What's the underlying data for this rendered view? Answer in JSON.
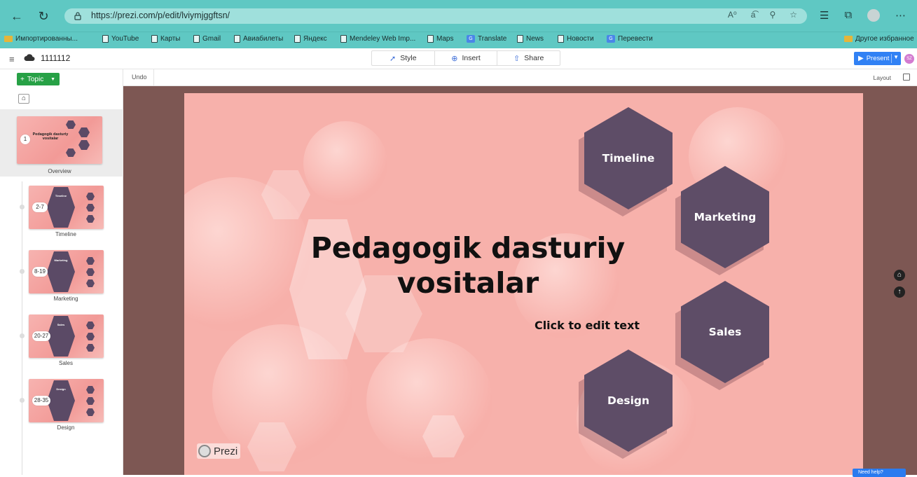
{
  "browser": {
    "url": "https://prezi.com/p/edit/lviymjggftsn/",
    "bookmarks": [
      {
        "label": "Импортированны...",
        "type": "folder"
      },
      {
        "label": "YouTube",
        "type": "page"
      },
      {
        "label": "Карты",
        "type": "page"
      },
      {
        "label": "Gmail",
        "type": "page"
      },
      {
        "label": "Авиабилеты",
        "type": "page"
      },
      {
        "label": "Яндекс",
        "type": "page"
      },
      {
        "label": "Mendeley Web Imp...",
        "type": "page"
      },
      {
        "label": "Maps",
        "type": "page"
      },
      {
        "label": "Translate",
        "type": "translate"
      },
      {
        "label": "News",
        "type": "page"
      },
      {
        "label": "Новости",
        "type": "page"
      },
      {
        "label": "Перевести",
        "type": "translate"
      }
    ],
    "other_favorites": "Другое избранное"
  },
  "app": {
    "doc_title": "1111112",
    "tabs": [
      {
        "label": "Style",
        "icon": "wand-icon"
      },
      {
        "label": "Insert",
        "icon": "plus-circle-icon"
      },
      {
        "label": "Share",
        "icon": "upload-icon"
      }
    ],
    "present_label": "Present",
    "user_initials": "SZ",
    "undo_label": "Undo",
    "layout_label": "Layout"
  },
  "sidebar": {
    "topic_button": "Topic",
    "overview": {
      "badge": "1",
      "title": "Pedagogik dasturiy vositalar",
      "label": "Overview"
    },
    "topics": [
      {
        "range": "2-7",
        "label": "Timeline",
        "hex_title": "Timeline"
      },
      {
        "range": "8-19",
        "label": "Marketing",
        "hex_title": "Marketing"
      },
      {
        "range": "20-27",
        "label": "Sales",
        "hex_title": "Sales"
      },
      {
        "range": "28-35",
        "label": "Design",
        "hex_title": "Design"
      }
    ]
  },
  "slide": {
    "title_line1": "Pedagogik dasturiy",
    "title_line2": "vositalar",
    "subtitle": "Click to edit text",
    "topics": [
      "Timeline",
      "Marketing",
      "Sales",
      "Design"
    ],
    "logo_text": "Prezi"
  },
  "help_label": "Need help?",
  "colors": {
    "browser_chrome": "#5fc8c3",
    "slide_bg": "#f7b1ab",
    "hex_fill": "#5e4d67",
    "stage_bg": "#7d5753",
    "present_blue": "#3181f4",
    "topic_green": "#27a146"
  }
}
